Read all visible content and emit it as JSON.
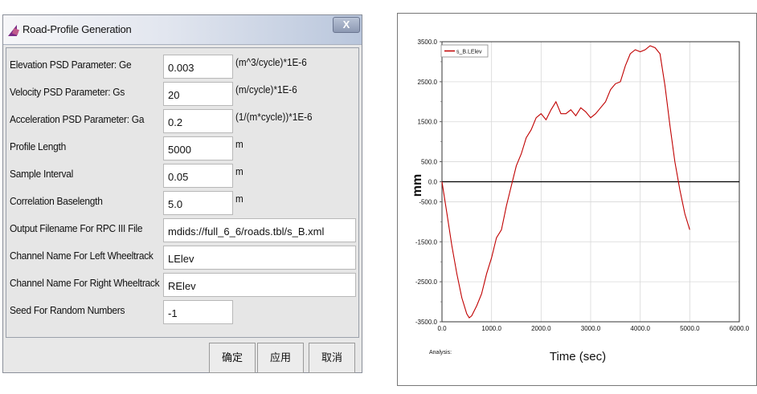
{
  "dialog": {
    "title": "Road-Profile Generation",
    "close_label": "X",
    "fields": [
      {
        "label": "Elevation PSD Parameter: Ge",
        "value": "0.003",
        "unit": "(m^3/cycle)*1E-6"
      },
      {
        "label": "Velocity PSD Parameter: Gs",
        "value": "20",
        "unit": "(m/cycle)*1E-6"
      },
      {
        "label": "Acceleration PSD Parameter: Ga",
        "value": "0.2",
        "unit": "(1/(m*cycle))*1E-6"
      },
      {
        "label": "Profile Length",
        "value": "5000",
        "unit": "m"
      },
      {
        "label": "Sample Interval",
        "value": "0.05",
        "unit": "m"
      },
      {
        "label": "Correlation Baselength",
        "value": "5.0",
        "unit": "m"
      },
      {
        "label": "Output Filename For RPC III File",
        "value": "mdids://full_6_6/roads.tbl/s_B.xml"
      },
      {
        "label": "Channel Name For Left Wheeltrack",
        "value": "LElev"
      },
      {
        "label": "Channel Name For Right Wheeltrack",
        "value": "RElev"
      },
      {
        "label": "Seed For Random Numbers",
        "value": "-1"
      }
    ],
    "buttons": {
      "ok": "确定",
      "apply": "应用",
      "cancel": "取消"
    }
  },
  "chart_data": {
    "type": "line",
    "xlabel": "Time (sec)",
    "ylabel": "mm",
    "footer_label": "Analysis:",
    "legend": "s_B.LElev",
    "legend_position": "top-left",
    "xlim": [
      0,
      6000
    ],
    "ylim": [
      -3500,
      3500
    ],
    "x_ticks": [
      "0.0",
      "1000.0",
      "2000.0",
      "3000.0",
      "4000.0",
      "5000.0",
      "6000.0"
    ],
    "y_ticks": [
      "3500.0",
      "2500.0",
      "1500.0",
      "500.0",
      "0.0",
      "-500.0",
      "-1500.0",
      "-2500.0",
      "-3500.0"
    ],
    "grid": true,
    "series_color": "#c00000",
    "series": [
      {
        "name": "s_B.LElev",
        "x": [
          0,
          100,
          200,
          300,
          400,
          500,
          550,
          600,
          700,
          800,
          900,
          1000,
          1100,
          1200,
          1300,
          1400,
          1500,
          1600,
          1700,
          1800,
          1900,
          2000,
          2100,
          2200,
          2300,
          2400,
          2500,
          2600,
          2700,
          2800,
          2900,
          3000,
          3100,
          3200,
          3300,
          3400,
          3500,
          3600,
          3700,
          3800,
          3900,
          4000,
          4100,
          4200,
          4300,
          4400,
          4500,
          4600,
          4700,
          4800,
          4900,
          5000
        ],
        "y": [
          0,
          -800,
          -1600,
          -2300,
          -2900,
          -3300,
          -3400,
          -3350,
          -3100,
          -2800,
          -2300,
          -1900,
          -1400,
          -1200,
          -600,
          -100,
          400,
          700,
          1100,
          1300,
          1600,
          1700,
          1550,
          1800,
          2000,
          1700,
          1700,
          1800,
          1650,
          1850,
          1750,
          1600,
          1700,
          1850,
          2000,
          2300,
          2450,
          2500,
          2900,
          3200,
          3300,
          3250,
          3300,
          3400,
          3350,
          3200,
          2400,
          1400,
          500,
          -200,
          -800,
          -1200
        ]
      }
    ]
  }
}
